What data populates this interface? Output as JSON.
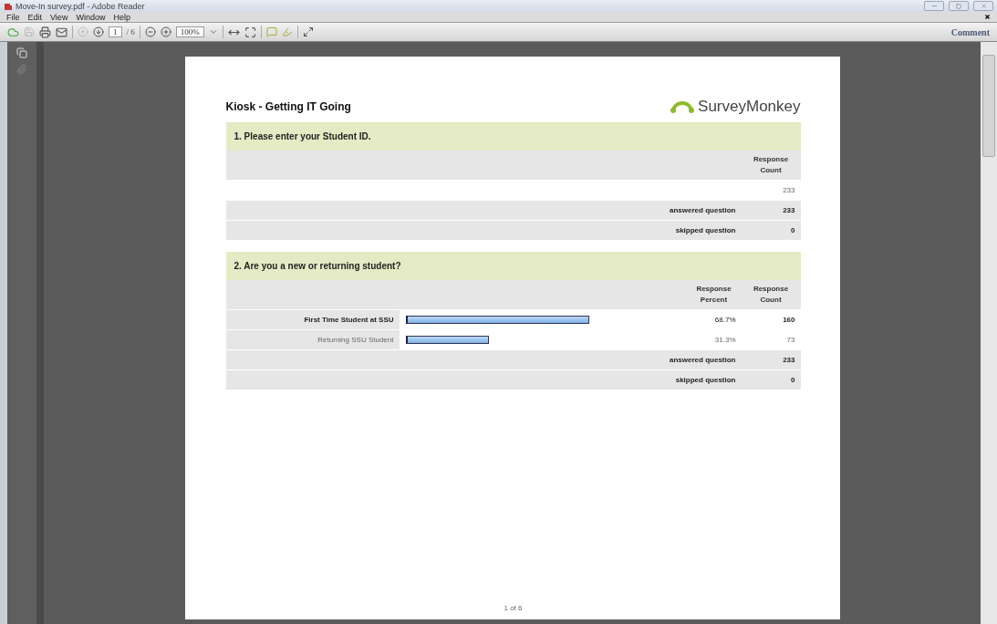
{
  "window": {
    "title": "Move-In survey.pdf - Adobe Reader"
  },
  "menu": [
    "File",
    "Edit",
    "View",
    "Window",
    "Help"
  ],
  "toolbar": {
    "page": "1",
    "page_total": "/ 6",
    "zoom": "100%",
    "comment": "Comment"
  },
  "document": {
    "title": "Kiosk - Getting IT Going",
    "logo": "SurveyMonkey",
    "questions": [
      {
        "kind": "text",
        "title": "1. Please enter your Student ID.",
        "columns": [
          "Response Count"
        ],
        "rows": [
          {
            "count": "233"
          }
        ],
        "summary": [
          {
            "label": "answered question",
            "value": "233"
          },
          {
            "label": "skipped question",
            "value": "0"
          }
        ]
      },
      {
        "kind": "choice",
        "title": "2. Are you a new or returning student?",
        "columns": [
          "Response Percent",
          "Response Count"
        ],
        "rows": [
          {
            "label": "First Time Student at SSU",
            "emphasis": true,
            "percent": "68.7%",
            "count": "160"
          },
          {
            "label": "Returning SSU Student",
            "emphasis": false,
            "percent": "31.3%",
            "count": "73"
          }
        ],
        "summary": [
          {
            "label": "answered question",
            "value": "233"
          },
          {
            "label": "skipped question",
            "value": "0"
          }
        ]
      }
    ],
    "footer": "1 of 6"
  }
}
